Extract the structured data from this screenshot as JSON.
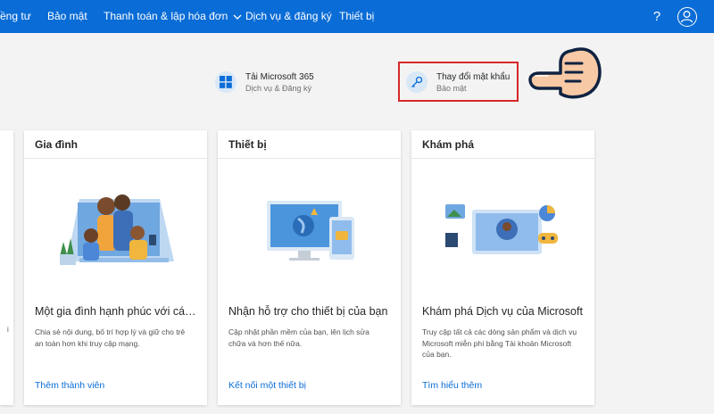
{
  "nav": {
    "items": [
      {
        "label": "ềng tư"
      },
      {
        "label": "Bảo mật"
      },
      {
        "label": "Thanh toán & lập hóa đơn"
      },
      {
        "label": "Dịch vụ & đăng ký"
      },
      {
        "label": "Thiết bị"
      }
    ],
    "help": "?"
  },
  "quick_links": [
    {
      "title": "Tải Microsoft 365",
      "subtitle": "Dịch vụ & Đăng ký",
      "icon": "windows-icon"
    },
    {
      "title": "Thay đổi mật khẩu",
      "subtitle": "Bảo mật",
      "icon": "key-icon"
    }
  ],
  "partial_card": {
    "text": "i"
  },
  "cards": [
    {
      "header": "Gia đình",
      "title": "Một gia đình hạnh phúc với các...",
      "desc": "Chia sẻ nội dung, bố trí hợp lý và giữ cho trẻ an toàn hơn khi truy cập mạng.",
      "link": "Thêm thành viên"
    },
    {
      "header": "Thiết bị",
      "title": "Nhận hỗ trợ cho thiết bị của bạn",
      "desc": "Cập nhật phần mềm của bạn, lên lịch sửa chữa và hơn thế nữa.",
      "link": "Kết nối một thiết bị"
    },
    {
      "header": "Khám phá",
      "title": "Khám phá Dịch vụ của Microsoft",
      "desc": "Truy cập tất cả các dòng sản phẩm và dịch vụ Microsoft miễn phí bằng Tài khoản Microsoft của bạn.",
      "link": "Tìm hiểu thêm"
    }
  ],
  "colors": {
    "nav_bg": "#0a6cd6",
    "link": "#0a6cd6",
    "highlight": "#d62828",
    "page_bg": "#f3f3f3"
  }
}
